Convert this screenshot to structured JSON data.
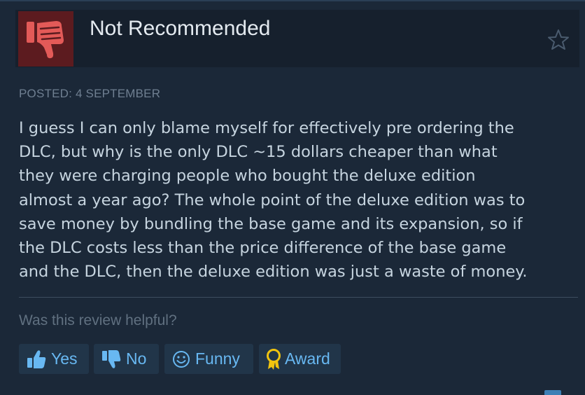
{
  "review": {
    "verdict": "Not Recommended",
    "posted": "POSTED: 4 SEPTEMBER",
    "body": "I guess I can only blame myself for effectively pre ordering the\nDLC, but why is the only DLC ~15 dollars cheaper than what\nthey were charging people who bought the deluxe edition\nalmost a year ago? The whole point of the deluxe edition was to\nsave money by bundling the base game and its expansion, so if\nthe DLC costs less than the price difference of the base game\nand the DLC, then the deluxe edition was just a waste of money."
  },
  "helpful": {
    "question": "Was this review helpful?",
    "buttons": {
      "yes": "Yes",
      "no": "No",
      "funny": "Funny",
      "award": "Award"
    }
  },
  "icons": {
    "verdict": "thumbs-down-icon",
    "favorite": "star-icon",
    "yes": "thumbs-up-icon",
    "no": "thumbs-down-icon",
    "funny": "smiley-icon",
    "award": "award-ribbon-icon"
  },
  "colors": {
    "background": "#1b2838",
    "header": "#16202d",
    "thumb_box": "#5c1b1f",
    "thumb": "#e35a58",
    "button_text": "#68b8f2",
    "award_icon": "#f1c40f"
  }
}
